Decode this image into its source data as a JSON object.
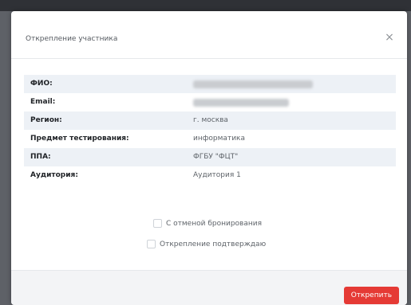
{
  "dialog": {
    "title": "Открепление участника",
    "close_label": "×"
  },
  "fields": [
    {
      "label": "ФИО:",
      "value": "",
      "redacted": true
    },
    {
      "label": "Email:",
      "value": "",
      "redacted": true
    },
    {
      "label": "Регион:",
      "value": "г. москва",
      "redacted": false
    },
    {
      "label": "Предмет тестирования:",
      "value": "информатика",
      "redacted": false
    },
    {
      "label": "ППА:",
      "value": "ФГБУ \"ФЦТ\"",
      "redacted": false
    },
    {
      "label": "Аудитория:",
      "value": "Аудитория 1",
      "redacted": false
    }
  ],
  "checkboxes": [
    {
      "label": "С отменой бронирования",
      "checked": false
    },
    {
      "label": "Открепление подтверждаю",
      "checked": false
    }
  ],
  "footer": {
    "detach_label": "Открепить"
  },
  "colors": {
    "accent": "#e53a35",
    "row_stripe": "#edf1f6",
    "backdrop": "#5e6167"
  }
}
